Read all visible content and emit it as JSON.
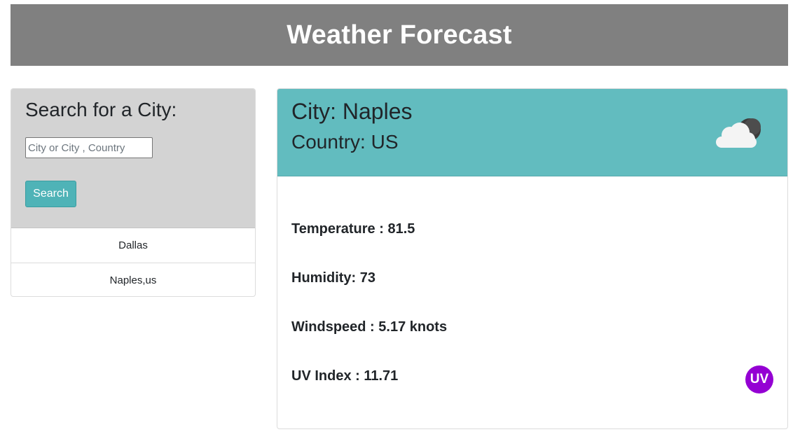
{
  "header": {
    "title": "Weather Forecast"
  },
  "search": {
    "title": "Search for a City:",
    "placeholder": "City or City , Country",
    "value": "",
    "button_label": "Search",
    "history": [
      "Dallas",
      "Naples,us"
    ]
  },
  "forecast": {
    "city_line": "City: Naples",
    "country_line": "Country: US",
    "weather_icon": "partly-cloudy-night-icon",
    "temperature_line": "Temperature : 81.5",
    "humidity_line": "Humidity: 73",
    "windspeed_line": "Windspeed : 5.17 knots",
    "uv_line": "UV Index : 11.71",
    "uv_badge_label": "UV",
    "uv_badge_color": "#9400d3"
  },
  "colors": {
    "header_bg": "#808080",
    "search_panel_bg": "#d3d3d3",
    "search_button_bg": "#4fb3b7",
    "forecast_header_bg": "#62bcbf"
  }
}
